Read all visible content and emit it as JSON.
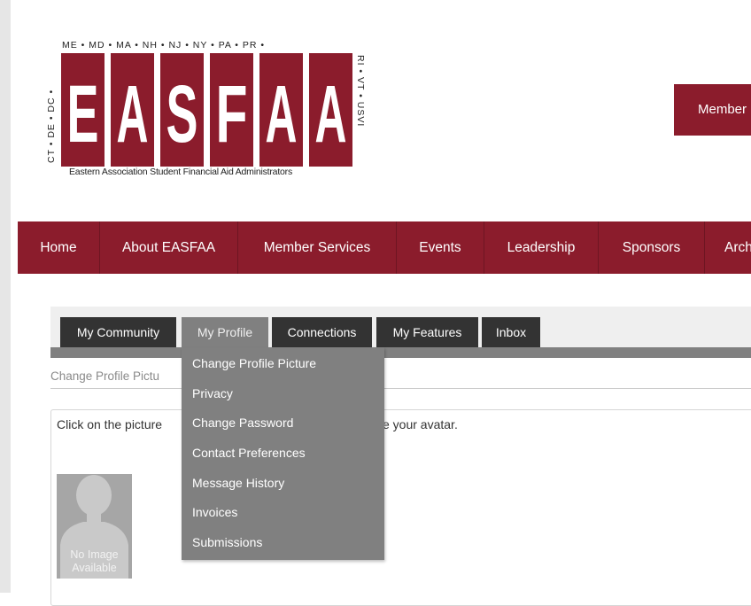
{
  "logo": {
    "top_text": "ME • MD • MA • NH • NJ • NY • PA • PR •",
    "left_text": "CT • DE • DC •",
    "right_text": "RI • VT • USVI",
    "letters": [
      "E",
      "A",
      "S",
      "F",
      "A",
      "A"
    ],
    "subtitle": "Eastern Association Student Financial Aid Administrators",
    "brand_color": "#8b1c2c"
  },
  "header": {
    "member_button": "Member"
  },
  "nav": {
    "items": [
      "Home",
      "About EASFAA",
      "Member Services",
      "Events",
      "Leadership",
      "Sponsors",
      "Arch"
    ]
  },
  "tabs": {
    "items": [
      "My Community",
      "My Profile",
      "Connections",
      "My Features",
      "Inbox"
    ],
    "active": "My Profile"
  },
  "dropdown": {
    "items": [
      "Change Profile Picture",
      "Privacy",
      "Change Password",
      "Contact Preferences",
      "Message History",
      "Invoices",
      "Submissions"
    ]
  },
  "page": {
    "section_title": "Change Profile Pictu",
    "instruction_left": "Click on the picture",
    "instruction_right": "e your avatar."
  },
  "avatar": {
    "line1": "No Image",
    "line2": "Available",
    "icon": "person-silhouette-icon"
  }
}
